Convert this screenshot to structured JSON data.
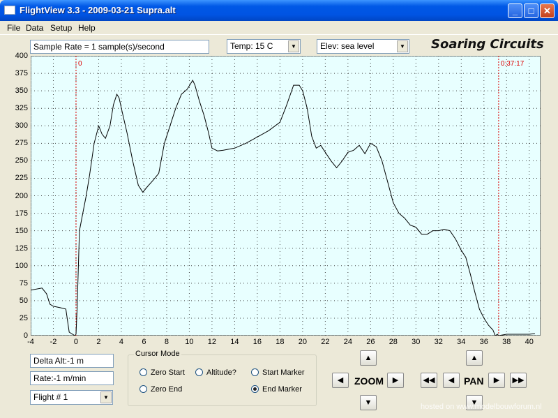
{
  "window": {
    "title": "FlightView 3.3 - 2009-03-21 Supra.alt",
    "min": "_",
    "max": "□",
    "close": "✕"
  },
  "menu": [
    "File",
    "Data",
    "Setup",
    "Help"
  ],
  "toolbar": {
    "sample_rate": "Sample Rate =  1 sample(s)/second",
    "temp": "Temp:  15 C",
    "elev": "Elev: sea level",
    "brand": "Soaring Circuits"
  },
  "chart_data": {
    "type": "line",
    "xlim": [
      -4,
      41
    ],
    "ylim": [
      0,
      400
    ],
    "x_ticks": [
      "-4",
      "-2",
      "0",
      "2",
      "4",
      "6",
      "8",
      "10",
      "12",
      "14",
      "16",
      "18",
      "20",
      "22",
      "24",
      "26",
      "28",
      "30",
      "32",
      "34",
      "36",
      "38",
      "40"
    ],
    "y_ticks": [
      "0",
      "25",
      "50",
      "75",
      "100",
      "125",
      "150",
      "175",
      "200",
      "225",
      "250",
      "275",
      "300",
      "325",
      "350",
      "375",
      "400"
    ],
    "grid": true,
    "start_marker": {
      "x": 0,
      "label": "0"
    },
    "end_marker": {
      "x": 37.3,
      "label": "0:37:17"
    },
    "series": [
      {
        "x": [
          -4,
          -3,
          -2.6,
          -2.3,
          -2,
          -1.4,
          -0.9,
          -0.6,
          -0.1,
          0,
          0.1,
          0.3,
          0.6,
          0.9,
          1.2,
          1.6,
          2,
          2.3,
          2.6,
          3,
          3.3,
          3.6,
          3.8,
          4.1,
          4.5,
          5,
          5.5,
          5.9,
          6.3,
          6.8,
          7.3,
          7.8,
          8.3,
          8.8,
          9.3,
          9.8,
          10.3,
          10.5,
          10.9,
          11.3,
          11.7,
          12,
          12.5,
          13,
          14,
          15,
          16,
          17,
          18,
          18.6,
          19.2,
          19.7,
          20,
          20.4,
          20.8,
          21.2,
          21.6,
          22,
          22.5,
          23,
          23.5,
          24,
          24.5,
          25,
          25.5,
          26,
          26.5,
          27,
          27.5,
          28,
          28.5,
          29,
          29.5,
          30,
          30.5,
          31,
          31.5,
          32,
          32.5,
          33,
          33.5,
          34,
          34.4,
          34.8,
          35.2,
          35.6,
          36,
          36.4,
          36.8,
          37,
          37.2,
          37.3,
          38,
          39,
          40,
          40.5
        ],
        "y": [
          65,
          68,
          60,
          45,
          42,
          40,
          38,
          5,
          0,
          2,
          40,
          150,
          175,
          200,
          230,
          275,
          300,
          288,
          282,
          300,
          330,
          345,
          340,
          318,
          290,
          250,
          215,
          205,
          213,
          222,
          232,
          275,
          300,
          325,
          345,
          352,
          365,
          358,
          335,
          315,
          290,
          268,
          264,
          265,
          268,
          275,
          284,
          293,
          305,
          330,
          358,
          358,
          350,
          325,
          285,
          268,
          272,
          262,
          250,
          240,
          250,
          262,
          265,
          272,
          260,
          275,
          270,
          250,
          220,
          190,
          175,
          168,
          158,
          155,
          145,
          145,
          150,
          150,
          152,
          150,
          138,
          122,
          112,
          88,
          62,
          38,
          25,
          15,
          8,
          0,
          2,
          0,
          2,
          2,
          2,
          3
        ]
      }
    ]
  },
  "bottom": {
    "delta_alt": "Delta Alt:-1 m",
    "rate": "Rate:-1 m/min",
    "flight": "Flight # 1"
  },
  "cursor_mode": {
    "title": "Cursor Mode",
    "zero_start": "Zero Start",
    "altitude": "Altitude?",
    "start_marker": "Start Marker",
    "zero_end": "Zero End",
    "end_marker": "End Marker"
  },
  "nav": {
    "zoom": "ZOOM",
    "pan": "PAN"
  },
  "watermark": "hosted on www.modelbouwforum.nl"
}
